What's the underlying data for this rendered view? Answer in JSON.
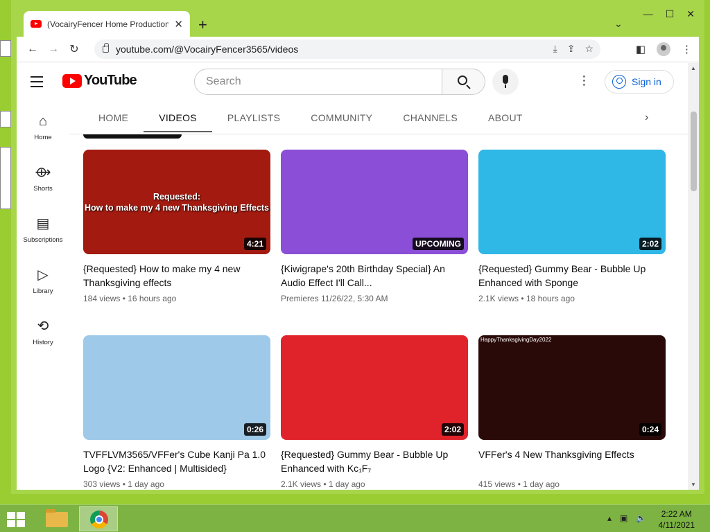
{
  "browser": {
    "tab_title": "(VocairyFencer Home Production",
    "url": "youtube.com/@VocairyFencer3565/videos",
    "new_tab": "+",
    "tab_close": "✕",
    "tab_search": "⌄",
    "controls": {
      "minimize": "—",
      "maximize": "☐",
      "close": "✕"
    }
  },
  "youtube": {
    "logo_text": "YouTube",
    "search_placeholder": "Search",
    "sign_in": "Sign in",
    "guide": [
      {
        "label": "Home",
        "icon": "⌂"
      },
      {
        "label": "Shorts",
        "icon": "⟴"
      },
      {
        "label": "Subscriptions",
        "icon": "▤"
      },
      {
        "label": "Library",
        "icon": "▷"
      },
      {
        "label": "History",
        "icon": "⟲"
      }
    ],
    "tabs": [
      "HOME",
      "VIDEOS",
      "PLAYLISTS",
      "COMMUNITY",
      "CHANNELS",
      "ABOUT"
    ],
    "active_tab": "VIDEOS",
    "videos": [
      {
        "title": "{Requested} How to make my 4 new Thanksgiving effects",
        "meta": "184 views • 16 hours ago",
        "duration": "4:21",
        "thumb_text_1": "Requested:",
        "thumb_text_2": "How to make my 4 new Thanksgiving Effects",
        "bg": "#a31a10"
      },
      {
        "title": "{Kiwigrape's 20th Birthday Special} An Audio Effect I'll Call...",
        "meta": "Premieres 11/26/22, 5:30 AM",
        "duration": "UPCOMING",
        "bg": "#8a4fd6"
      },
      {
        "title": "{Requested} Gummy Bear - Bubble Up Enhanced with Sponge",
        "meta": "2.1K views • 18 hours ago",
        "duration": "2:02",
        "bg": "#2fb7e6"
      },
      {
        "title": "TVFFLVM3565/VFFer's Cube Kanji Pa 1.0 Logo {V2: Enhanced | Multisided}",
        "meta": "303 views • 1 day ago",
        "duration": "0:26",
        "bg": "#9ec9e8"
      },
      {
        "title": "{Requested} Gummy Bear - Bubble Up Enhanced with Kc₁F₇",
        "meta": "2.1K views • 1 day ago",
        "duration": "2:02",
        "bg": "#e0222a"
      },
      {
        "title": "VFFer's 4 New Thanksgiving Effects",
        "meta": "415 views • 1 day ago",
        "duration": "0:24",
        "corner_text": "HappyThanksgivingDay2022",
        "bg": "#2a0a08"
      }
    ]
  },
  "taskbar": {
    "time": "2:22 AM",
    "date": "4/11/2021"
  }
}
